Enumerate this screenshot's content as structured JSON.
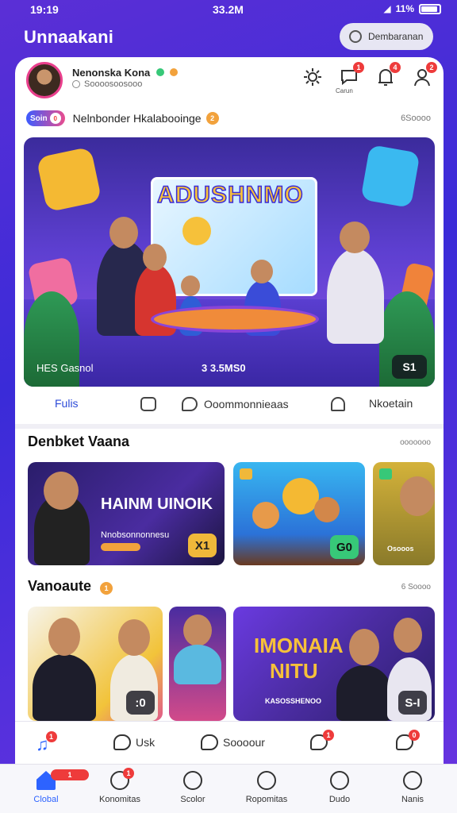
{
  "status": {
    "time": "19:19",
    "center": "33.2M",
    "right": "11%"
  },
  "app": {
    "title": "Unnaakani",
    "header_button": "Dembaranan"
  },
  "profile": {
    "name": "Nenonska Kona",
    "subtitle": "Soooosoosooo"
  },
  "top_icons": [
    {
      "name": "settings-icon",
      "badge": ""
    },
    {
      "name": "chat-icon",
      "badge": "1",
      "label": "Carun"
    },
    {
      "name": "notification-icon",
      "badge": "4"
    },
    {
      "name": "profile-icon",
      "badge": "2"
    }
  ],
  "highlight": {
    "chip": "Soin",
    "chip_badge": "0",
    "title": "Nelnbonder Hkalabooinge",
    "count": "2",
    "right": "6Soooo"
  },
  "hero": {
    "title": "ADUSHNMO",
    "caption_left": "HES Gasnol",
    "caption_center": "3 3.5MS0",
    "badge": "S1"
  },
  "actions": {
    "a1": "Fulis",
    "a2": "Ooommonnieaas",
    "a3": "Nkoetain"
  },
  "section1": {
    "title": "Denbket Vaana",
    "right": "ooooooo",
    "tiles": [
      {
        "headline": "HAINM UINOIK",
        "sub": "Nnobsonnonnesu",
        "badge": "X1"
      },
      {
        "badge": "G0"
      },
      {
        "sub": "Osooos",
        "badge": ""
      }
    ]
  },
  "section2": {
    "title": "Vanoaute",
    "count": "1",
    "right": "6 Soooo",
    "tiles": [
      {
        "badge": ":0"
      },
      {
        "badge": ""
      },
      {
        "headline1": "IMONAIA",
        "headline2": "NITU",
        "sub": "KASOSSHENOO",
        "badge": "S-I"
      }
    ]
  },
  "subnav": [
    {
      "label": "",
      "badge": "1"
    },
    {
      "label": "Usk",
      "badge": ""
    },
    {
      "label": "Soooour",
      "badge": ""
    },
    {
      "label": "",
      "badge": "1"
    },
    {
      "label": "",
      "badge": "0"
    }
  ],
  "tabbar": [
    {
      "label": "Clobal",
      "badge": "1"
    },
    {
      "label": "Konomitas",
      "badge": "1"
    },
    {
      "label": "Scolor",
      "badge": ""
    },
    {
      "label": "Ropomitas",
      "badge": ""
    },
    {
      "label": "Dudo",
      "badge": ""
    },
    {
      "label": "Nanis",
      "badge": ""
    }
  ],
  "colors": {
    "accent": "#2d63ff",
    "brand": "#5b2fd6",
    "badge": "#ee3b3b"
  }
}
